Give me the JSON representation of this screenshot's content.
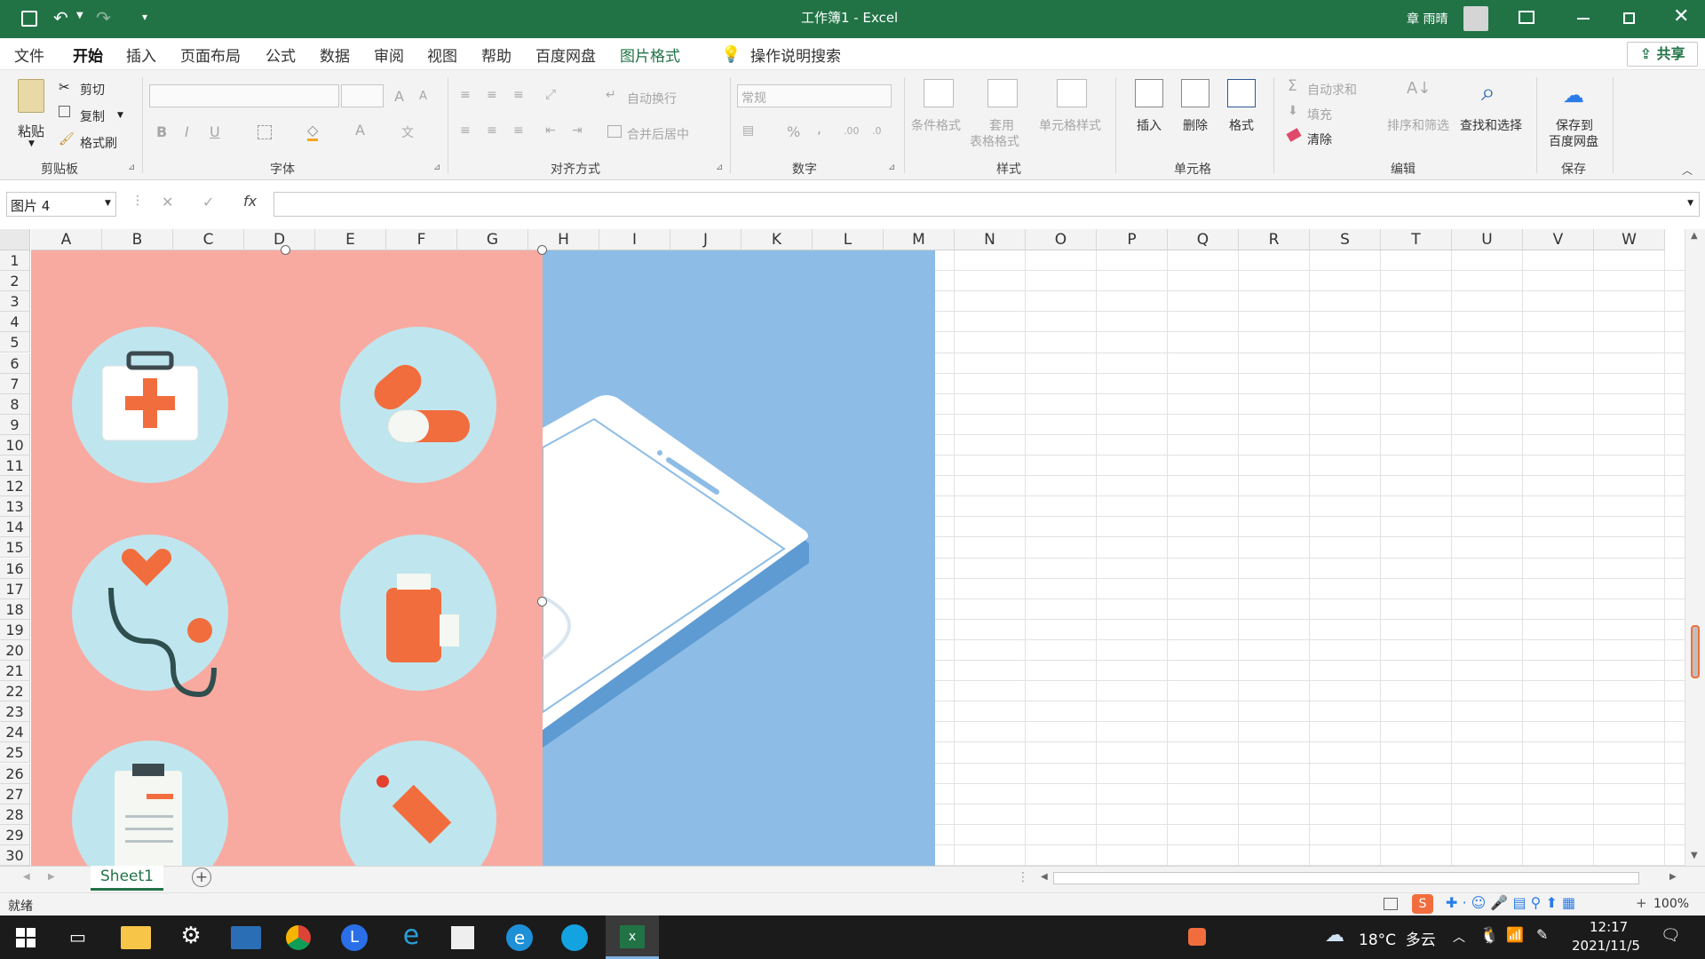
{
  "window": {
    "title": "工作簿1  -  Excel",
    "user": "章 雨晴"
  },
  "tabs": [
    "文件",
    "开始",
    "插入",
    "页面布局",
    "公式",
    "数据",
    "审阅",
    "视图",
    "帮助",
    "百度网盘",
    "图片格式"
  ],
  "tell_me": "操作说明搜索",
  "share": "共享",
  "ribbon": {
    "clipboard": {
      "paste": "粘贴",
      "cut": "剪切",
      "copy": "复制",
      "format_painter": "格式刷",
      "label": "剪贴板"
    },
    "font": {
      "label": "字体",
      "bold": "B",
      "italic": "I",
      "underline": "U",
      "grow": "A",
      "shrink": "A",
      "font_color": "A"
    },
    "alignment": {
      "wrap": "自动换行",
      "merge": "合并后居中",
      "label": "对齐方式"
    },
    "number": {
      "format": "常规",
      "percent": "%",
      "comma": ",",
      "label": "数字"
    },
    "styles": {
      "conditional": "条件格式",
      "table_line1": "套用",
      "table_line2": "表格格式",
      "cell_styles": "单元格样式",
      "label": "样式"
    },
    "cells": {
      "insert": "插入",
      "delete": "删除",
      "format": "格式",
      "label": "单元格"
    },
    "editing": {
      "autosum": "自动求和",
      "fill": "填充",
      "clear": "清除",
      "sort": "排序和筛选",
      "find": "查找和选择",
      "label": "编辑"
    },
    "save": {
      "line1": "保存到",
      "line2": "百度网盘",
      "label": "保存"
    }
  },
  "formula_bar": {
    "name_box": "图片 4",
    "fx": "fx",
    "cancel": "✕",
    "enter": "✓",
    "value": ""
  },
  "columns": [
    "A",
    "B",
    "C",
    "D",
    "E",
    "F",
    "G",
    "H",
    "I",
    "J",
    "K",
    "L",
    "M",
    "N",
    "O",
    "P",
    "Q",
    "R",
    "S",
    "T",
    "U",
    "V",
    "W"
  ],
  "rows": [
    "1",
    "2",
    "3",
    "4",
    "5",
    "6",
    "7",
    "8",
    "9",
    "10",
    "11",
    "12",
    "13",
    "14",
    "15",
    "16",
    "17",
    "18",
    "19",
    "20",
    "21",
    "22",
    "23",
    "24",
    "25",
    "26",
    "27",
    "28",
    "29",
    "30"
  ],
  "sheet": {
    "name": "Sheet1",
    "add": "+"
  },
  "status": {
    "ready": "就绪",
    "zoom": "100%"
  },
  "taskbar": {
    "weather": "18°C  多云",
    "time": "12:17",
    "date": "2021/11/5"
  },
  "colors": {
    "excel_green": "#217346",
    "pink": "#f9aaa0",
    "blue": "#8dbde6",
    "circle": "#bfe6ee",
    "orange": "#f26d3d"
  }
}
